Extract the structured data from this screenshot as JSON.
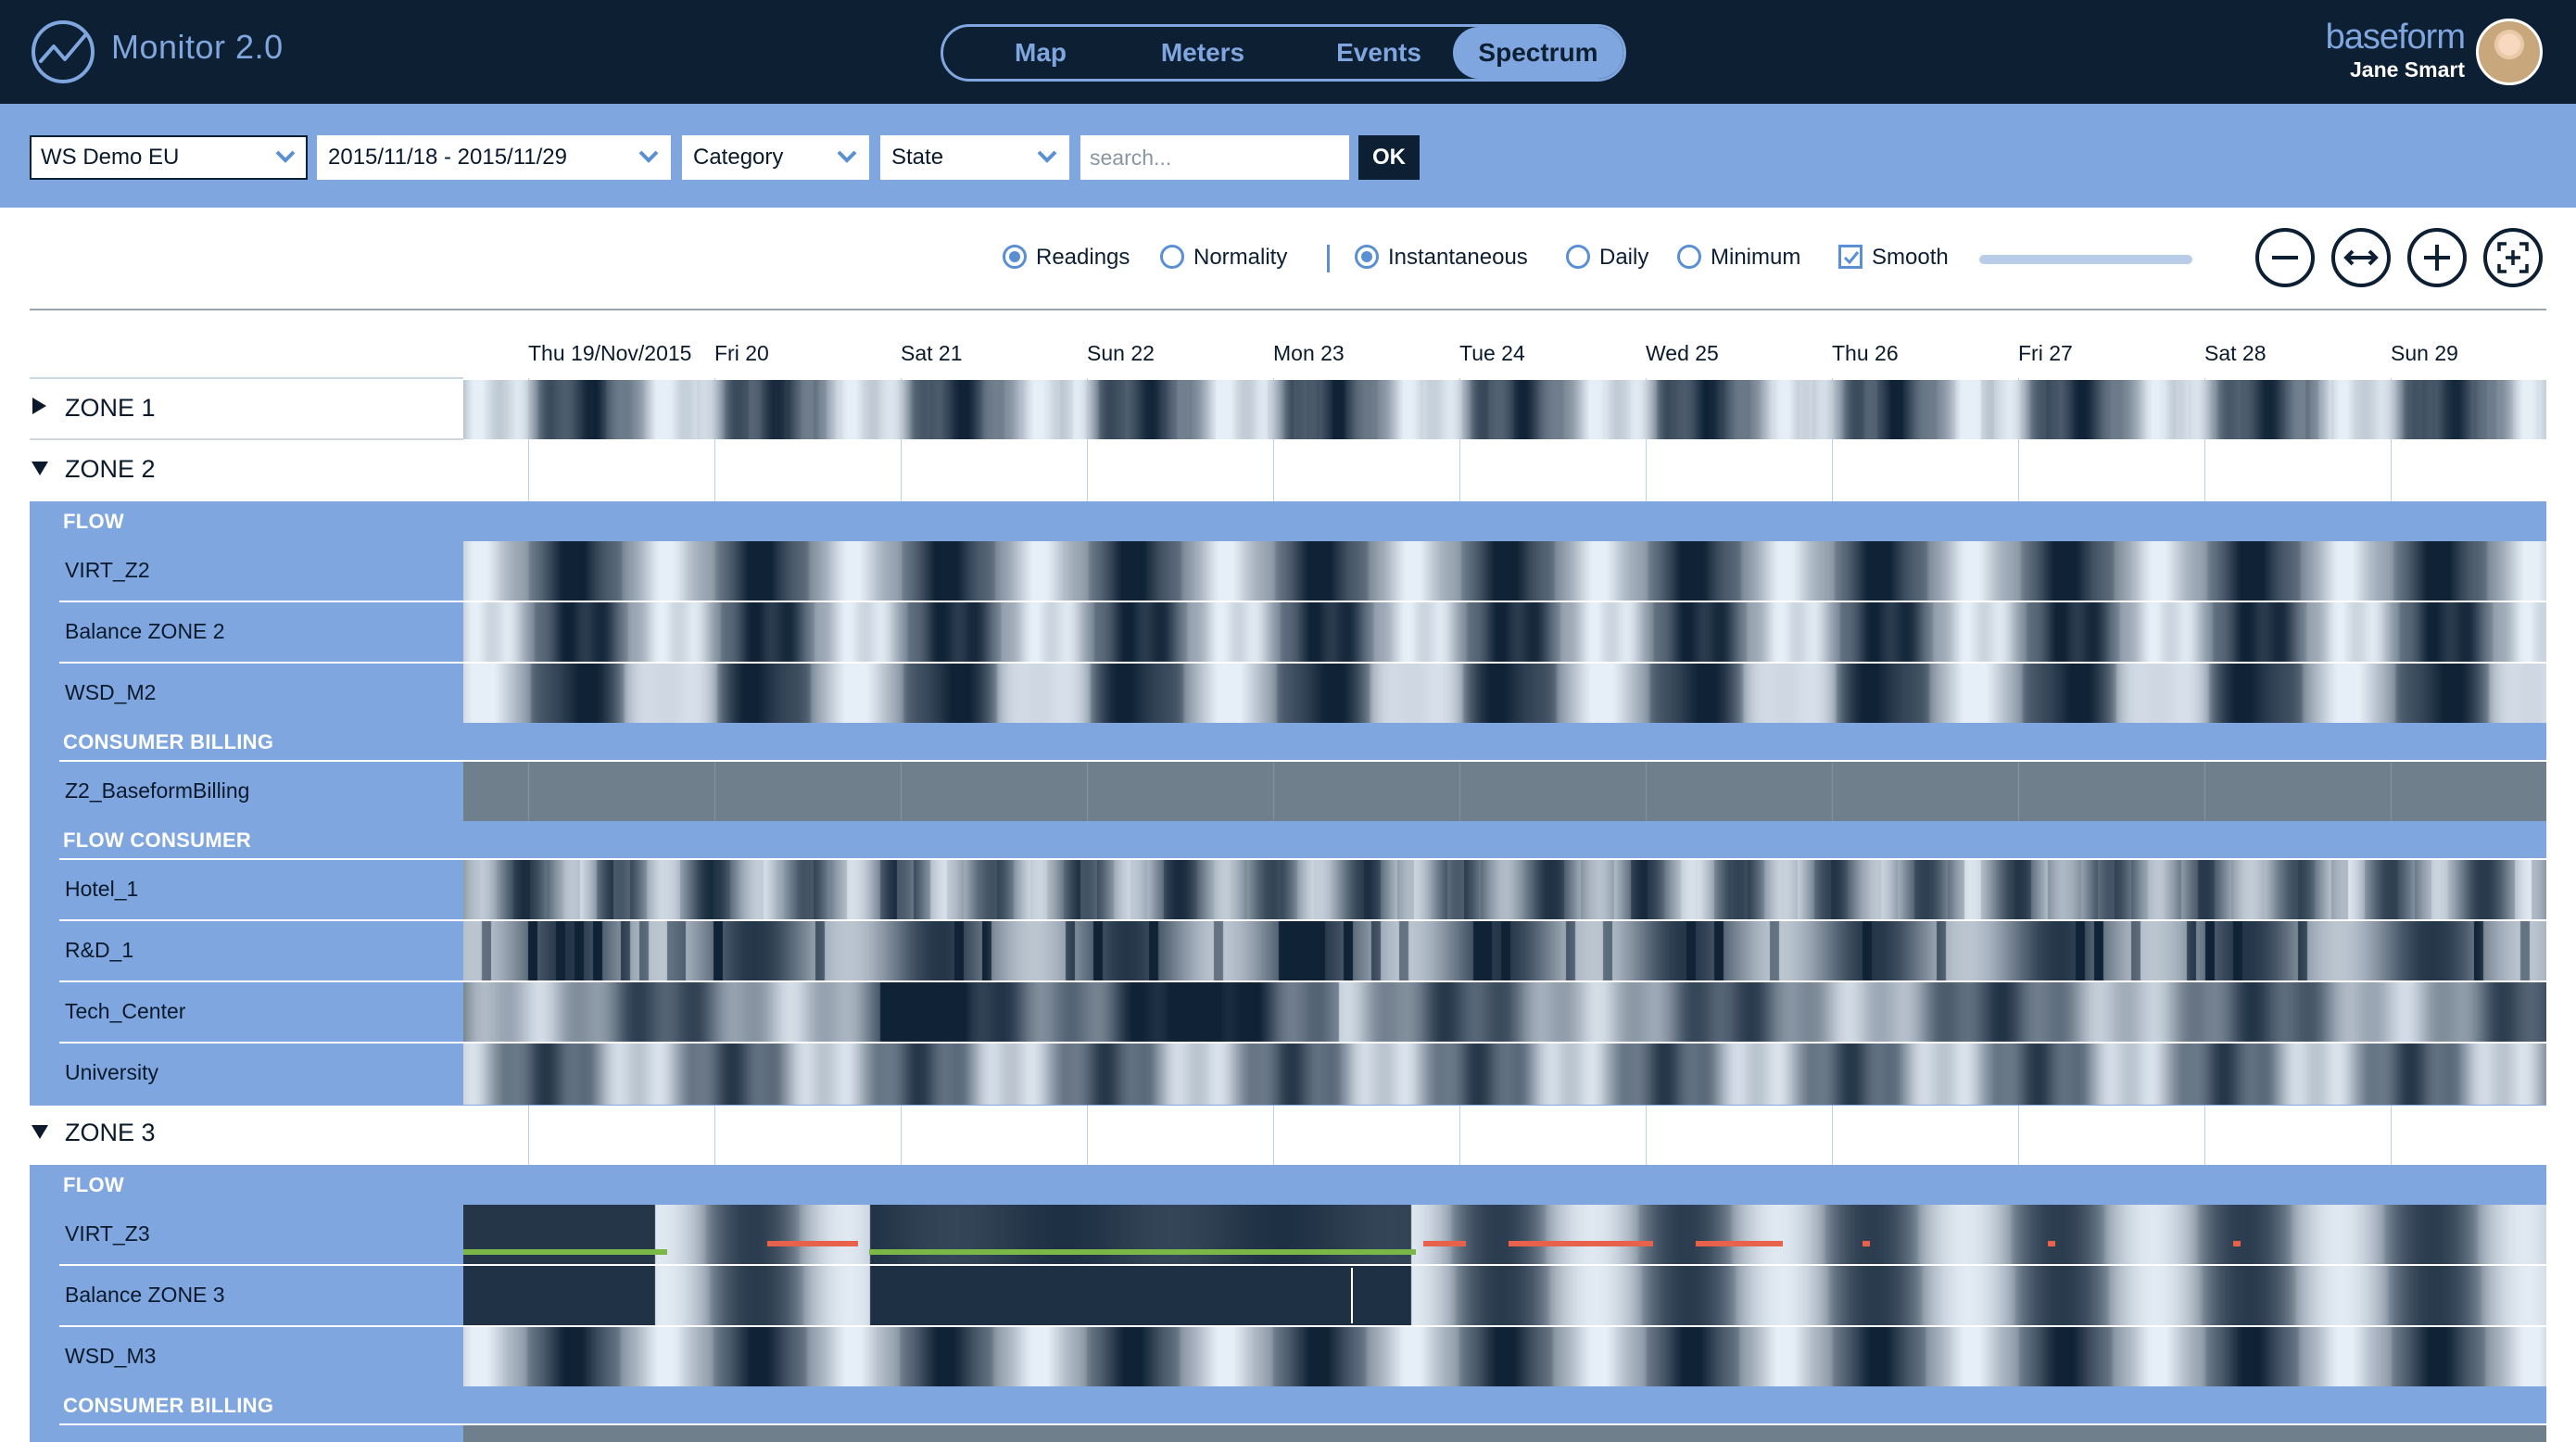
{
  "app": {
    "title": "Monitor 2.0"
  },
  "nav": {
    "tabs": [
      {
        "label": "Map",
        "active": false
      },
      {
        "label": "Meters",
        "active": false
      },
      {
        "label": "Events",
        "active": false
      },
      {
        "label": "Spectrum",
        "active": true
      }
    ]
  },
  "brand": {
    "logo_text": "baseform",
    "user_name": "Jane Smart"
  },
  "filters": {
    "network": "WS Demo EU",
    "date_range": "2015/11/18 - 2015/11/29",
    "category": "Category",
    "state": "State",
    "search_placeholder": "search...",
    "ok_label": "OK"
  },
  "options": {
    "readings": "Readings",
    "normality": "Normality",
    "instantaneous": "Instantaneous",
    "daily": "Daily",
    "minimum": "Minimum",
    "smooth": "Smooth",
    "selected_mode": "Readings",
    "selected_aggregation": "Instantaneous",
    "smooth_checked": true
  },
  "timeline": {
    "days": [
      "Thu 19/Nov/2015",
      "Fri 20",
      "Sat 21",
      "Sun 22",
      "Mon 23",
      "Tue 24",
      "Wed 25",
      "Thu 26",
      "Fri 27",
      "Sat 28",
      "Sun 29"
    ]
  },
  "zones": {
    "zone1": {
      "label": "ZONE 1",
      "expanded": false
    },
    "zone2": {
      "label": "ZONE 2",
      "expanded": true
    },
    "zone3": {
      "label": "ZONE 3",
      "expanded": true
    }
  },
  "categories": {
    "flow": "FLOW",
    "consumer_billing": "CONSUMER BILLING",
    "flow_consumer": "FLOW CONSUMER"
  },
  "meters": {
    "virt_z2": "VIRT_Z2",
    "balance_z2": "Balance ZONE 2",
    "wsd_m2": "WSD_M2",
    "z2_billing": "Z2_BaseformBilling",
    "hotel_1": "Hotel_1",
    "rd_1": "R&D_1",
    "tech_center": "Tech_Center",
    "university": "University",
    "virt_z3": "VIRT_Z3",
    "balance_z3": "Balance ZONE 3",
    "wsd_m3": "WSD_M3"
  },
  "colors": {
    "header_bg": "#0d1f33",
    "accent": "#7fa6de",
    "heat_dark": "#0f2236",
    "heat_light": "#e6eef7",
    "status_ok": "#7ab648",
    "status_alarm": "#e8624b",
    "billing_fill": "#6f7f8c"
  }
}
